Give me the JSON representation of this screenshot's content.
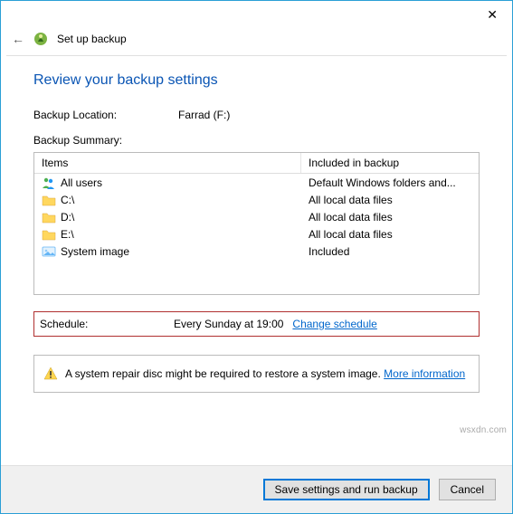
{
  "window": {
    "title": "Set up backup",
    "close_glyph": "✕"
  },
  "page": {
    "heading": "Review your backup settings"
  },
  "location": {
    "label": "Backup Location:",
    "value": "Farrad (F:)"
  },
  "summary": {
    "label": "Backup Summary:",
    "columns": {
      "items": "Items",
      "included": "Included in backup"
    },
    "rows": [
      {
        "icon": "users",
        "item": "All users",
        "included": "Default Windows folders and..."
      },
      {
        "icon": "folder",
        "item": "C:\\",
        "included": "All local data files"
      },
      {
        "icon": "folder",
        "item": "D:\\",
        "included": "All local data files"
      },
      {
        "icon": "folder",
        "item": "E:\\",
        "included": "All local data files"
      },
      {
        "icon": "image",
        "item": "System image",
        "included": "Included"
      }
    ]
  },
  "schedule": {
    "label": "Schedule:",
    "value": "Every Sunday at 19:00",
    "change_link": "Change schedule"
  },
  "warning": {
    "text": "A system repair disc might be required to restore a system image. ",
    "link": "More information"
  },
  "buttons": {
    "primary": "Save settings and run backup",
    "cancel": "Cancel"
  },
  "watermark": "wsxdn.com"
}
